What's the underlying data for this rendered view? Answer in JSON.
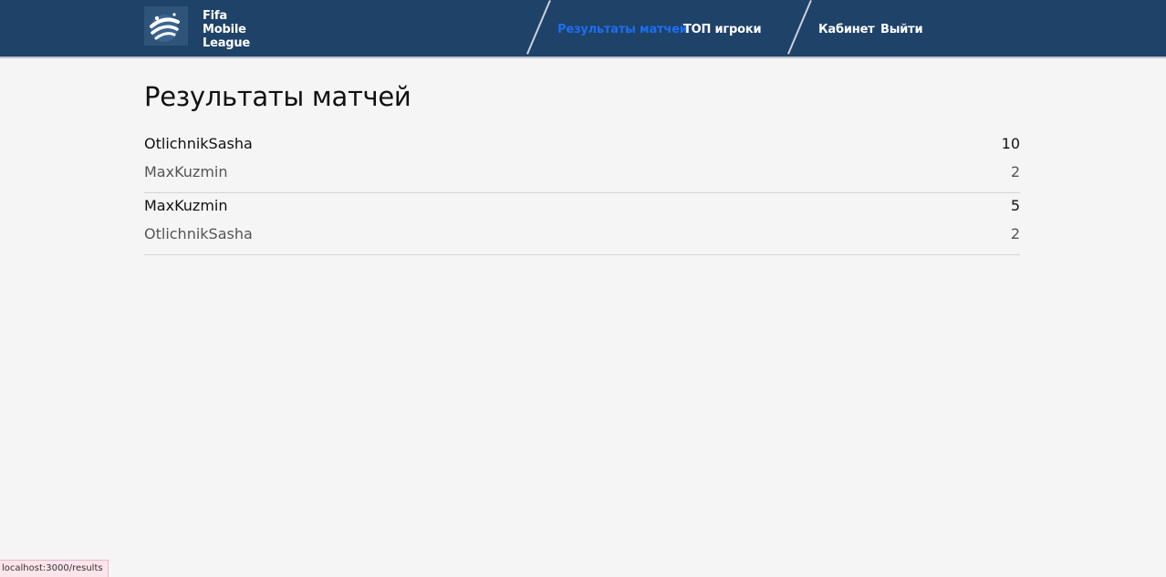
{
  "header": {
    "logo_lines": [
      "Fifa",
      "Mobile",
      "League"
    ],
    "nav": {
      "results": "Результаты матчей",
      "top_players": "ТОП игроки",
      "cabinet": "Кабинет",
      "logout": "Выйти"
    },
    "active_nav": "results"
  },
  "main": {
    "title": "Результаты матчей",
    "matches": [
      {
        "winner": {
          "name": "OtlichnikSasha",
          "score": "10"
        },
        "loser": {
          "name": "MaxKuzmin",
          "score": "2"
        }
      },
      {
        "winner": {
          "name": "MaxKuzmin",
          "score": "5"
        },
        "loser": {
          "name": "OtlichnikSasha",
          "score": "2"
        }
      }
    ]
  },
  "status_bar": {
    "url": "localhost:3000/results"
  },
  "colors": {
    "header_bg": "#1f4268",
    "active_link": "#1c6ff0",
    "page_bg": "#f5f5f5"
  }
}
